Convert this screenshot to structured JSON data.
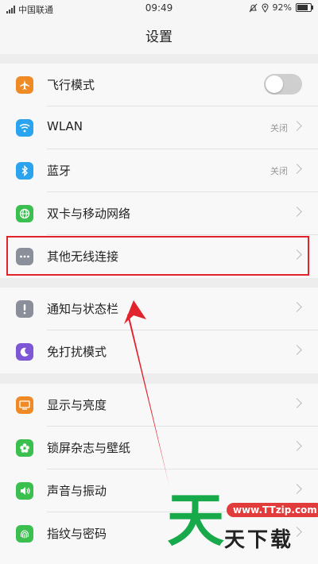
{
  "status_bar": {
    "carrier": "中国联通",
    "time": "09:49",
    "battery": "92%"
  },
  "header": {
    "title": "设置"
  },
  "groups": [
    {
      "items": [
        {
          "label": "飞行模式",
          "icon": "airplane-icon",
          "color": "#f08a24",
          "control": "toggle",
          "toggle_on": false
        },
        {
          "label": "WLAN",
          "icon": "wifi-icon",
          "color": "#2ba4f0",
          "value": "关闭"
        },
        {
          "label": "蓝牙",
          "icon": "bluetooth-icon",
          "color": "#2ba4f0",
          "value": "关闭"
        },
        {
          "label": "双卡与移动网络",
          "icon": "globe-icon",
          "color": "#3bbf4f"
        },
        {
          "label": "其他无线连接",
          "icon": "more-icon",
          "color": "#8a8f99"
        }
      ]
    },
    {
      "items": [
        {
          "label": "通知与状态栏",
          "icon": "notification-icon",
          "color": "#8a8f99"
        },
        {
          "label": "免打扰模式",
          "icon": "moon-icon",
          "color": "#7e57d6"
        }
      ]
    },
    {
      "items": [
        {
          "label": "显示与亮度",
          "icon": "display-icon",
          "color": "#f08a24"
        },
        {
          "label": "锁屏杂志与壁纸",
          "icon": "flower-icon",
          "color": "#3bbf4f"
        },
        {
          "label": "声音与振动",
          "icon": "speaker-icon",
          "color": "#3bbf4f"
        },
        {
          "label": "指纹与密码",
          "icon": "fingerprint-icon",
          "color": "#3bbf4f"
        }
      ]
    }
  ],
  "annotation": {
    "highlight_color": "#e2232e",
    "arrow_color": "#e2232e"
  },
  "watermark": {
    "glyph": "天",
    "url": "www.TTzip.com",
    "name": "天下载"
  }
}
